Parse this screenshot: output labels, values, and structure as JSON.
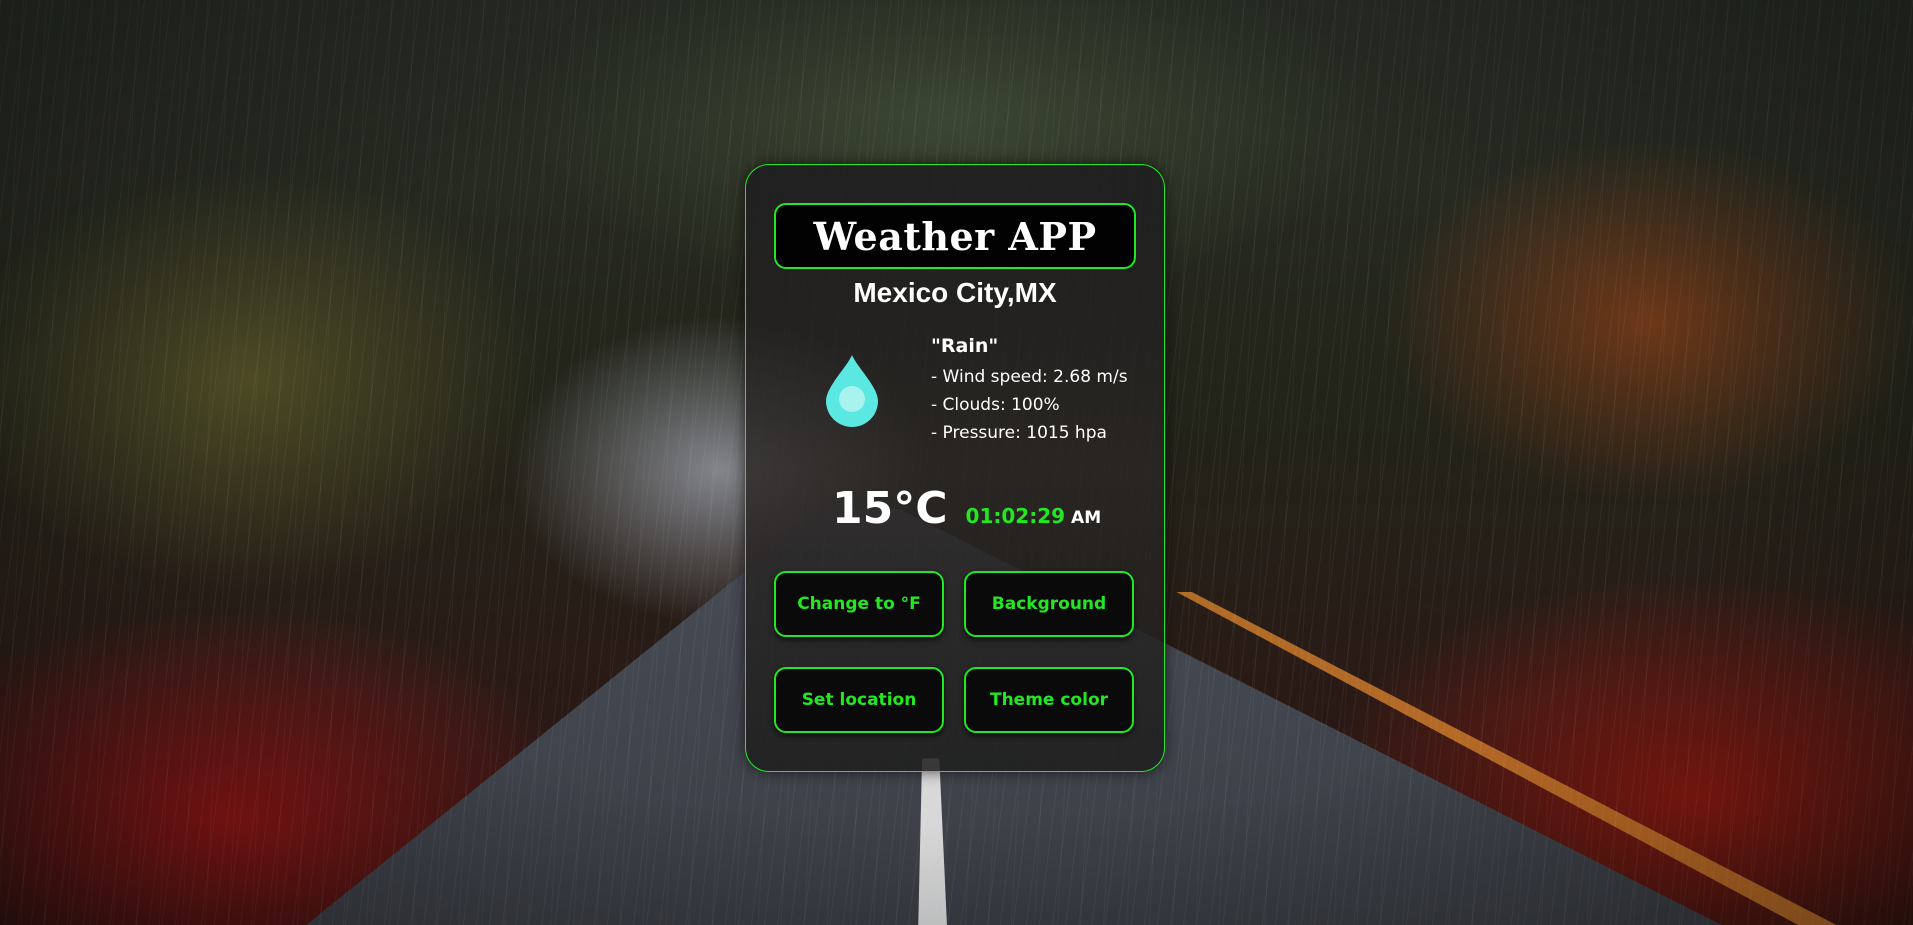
{
  "app": {
    "title": "Weather APP"
  },
  "location": "Mexico City,MX",
  "weather": {
    "condition": "\"Rain\"",
    "icon": "raindrop-icon",
    "icon_color": "#5ce8e2",
    "details": [
      "- Wind speed: 2.68 m/s",
      "- Clouds: 100%",
      "- Pressure: 1015 hpa"
    ],
    "temperature": "15°C"
  },
  "clock": {
    "time": "01:02:29",
    "period": "AM"
  },
  "buttons": {
    "change_unit": "Change to °F",
    "background": "Background",
    "set_location": "Set location",
    "theme_color": "Theme color"
  },
  "theme": {
    "accent": "#22e822",
    "text": "#ffffff",
    "card_bg": "#1c1c1e"
  }
}
